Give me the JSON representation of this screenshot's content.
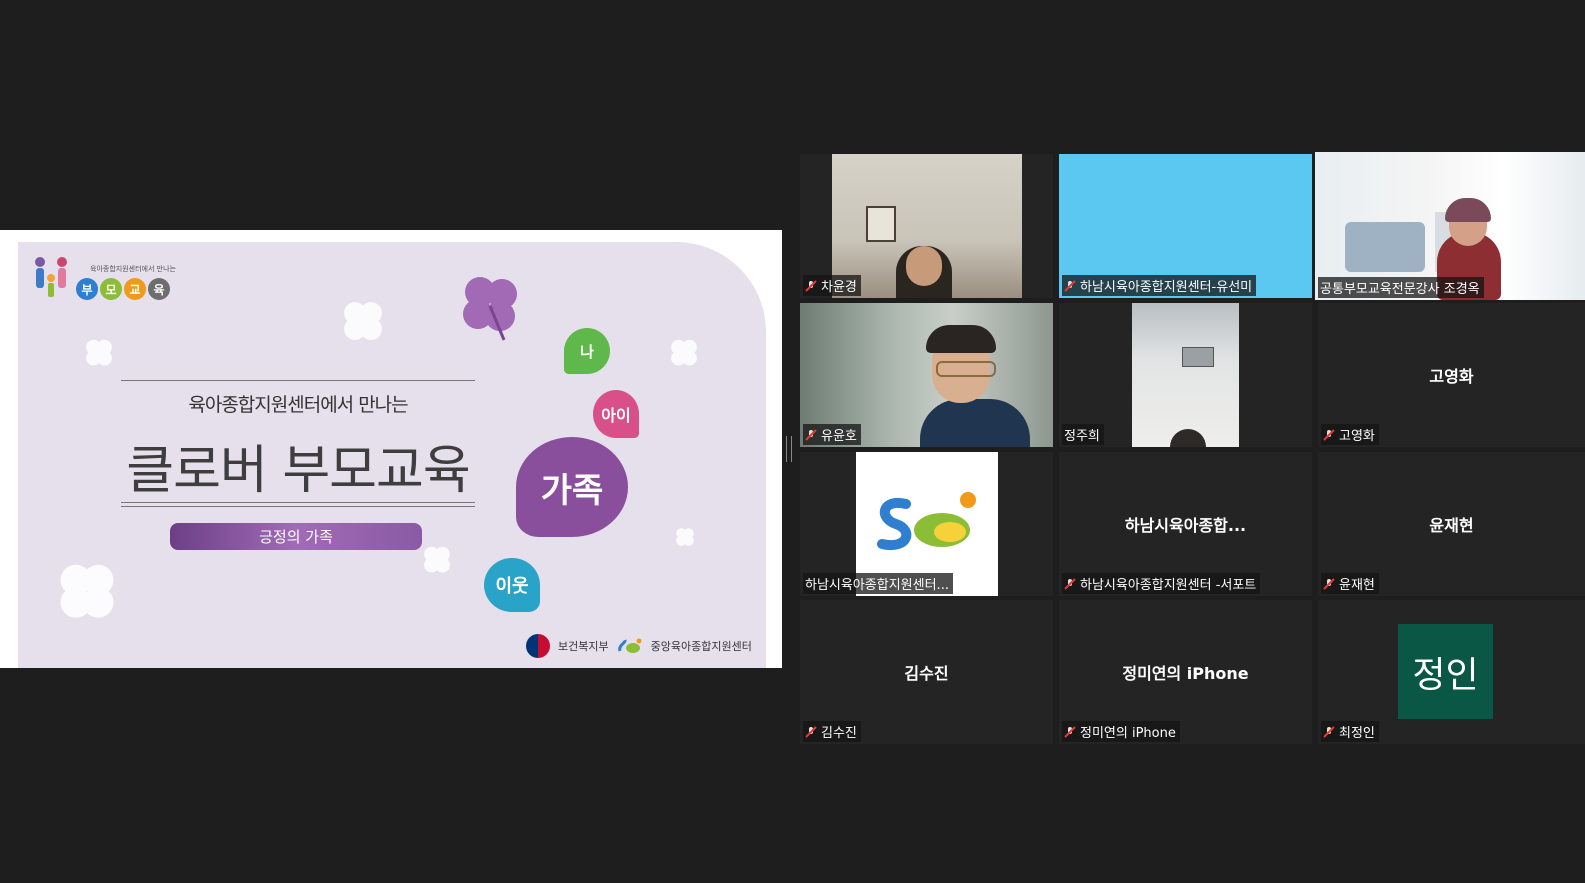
{
  "slide": {
    "brand_subtitle": "육아종합지원센터에서 만나는",
    "brand_chars": [
      "부",
      "모",
      "교",
      "육"
    ],
    "brand_colors": [
      "#2f7fd1",
      "#8cbd36",
      "#f19a1a",
      "#6e6e6e"
    ],
    "subtitle": "육아종합지원센터에서 만나는",
    "title": "클로버 부모교육",
    "pill_text": "긍정의 가족",
    "hearts": [
      {
        "text": "나",
        "color": "#5fb84a"
      },
      {
        "text": "아이",
        "color": "#d94f8a"
      },
      {
        "text": "가족",
        "color": "#8a4f9c"
      },
      {
        "text": "이웃",
        "color": "#2aa3c9"
      }
    ],
    "footer_ministry": "보건복지부",
    "footer_center": "중앙육아종합지원센터"
  },
  "participants": [
    {
      "label": "차윤경",
      "center": "",
      "muted": true
    },
    {
      "label": "하남시육아종합지원센터-유선미",
      "center": "",
      "muted": true
    },
    {
      "label": "공통부모교육전문강사 조경옥",
      "center": "",
      "muted": false,
      "speaking": true
    },
    {
      "label": "유윤호",
      "center": "",
      "muted": true
    },
    {
      "label": "정주희",
      "center": "",
      "muted": false
    },
    {
      "label": "고영화",
      "center": "고영화",
      "muted": true
    },
    {
      "label": "하남시육아종합지원센터...",
      "center": "",
      "muted": false
    },
    {
      "label": "하남시육아종합지원센터 -서포트",
      "center": "하남시육아종합...",
      "muted": true
    },
    {
      "label": "윤재현",
      "center": "윤재현",
      "muted": true
    },
    {
      "label": "김수진",
      "center": "김수진",
      "muted": true
    },
    {
      "label": "정미연의 iPhone",
      "center": "정미연의 iPhone",
      "muted": true
    },
    {
      "label": "최정인",
      "center": "",
      "muted": true,
      "avatar": "정인",
      "avatar_color": "#0a5746"
    }
  ]
}
